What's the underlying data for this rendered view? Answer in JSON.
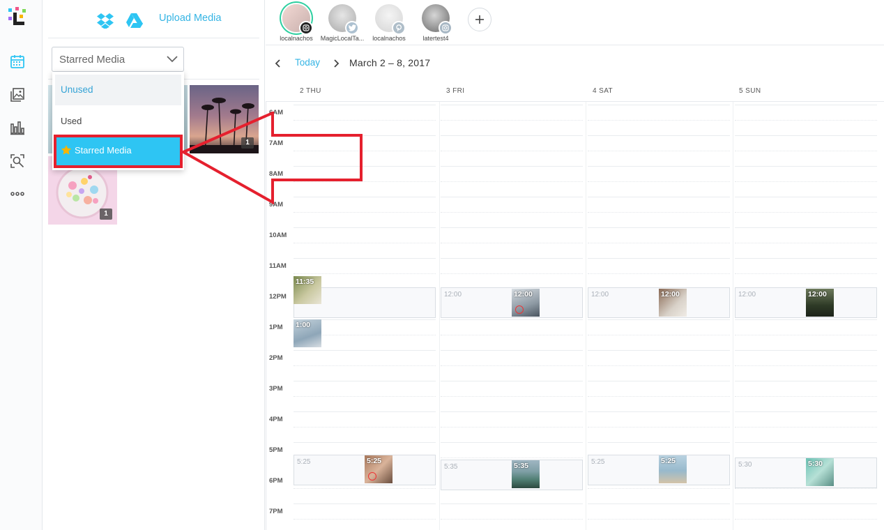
{
  "media_panel": {
    "upload_label": "Upload Media",
    "filter_value": "Starred Media",
    "dropdown": {
      "items": [
        {
          "label": "Unused",
          "state": "hover"
        },
        {
          "label": "Used",
          "state": "normal"
        },
        {
          "label": "Starred Media",
          "state": "selected"
        }
      ]
    },
    "thumbs": [
      {
        "badge": "1"
      },
      {
        "badge": "1"
      }
    ]
  },
  "accounts": [
    {
      "name": "localnachos",
      "network": "instagram",
      "active": true
    },
    {
      "name": "MagicLocalTa...",
      "network": "twitter",
      "active": false
    },
    {
      "name": "localnachos",
      "network": "pinterest",
      "active": false
    },
    {
      "name": "latertest4",
      "network": "instagram",
      "active": false
    }
  ],
  "datenav": {
    "today_label": "Today",
    "range": "March 2 – 8, 2017"
  },
  "days": [
    "2 THU",
    "3 FRI",
    "4 SAT",
    "5 SUN"
  ],
  "hours": [
    "6AM",
    "7AM",
    "8AM",
    "9AM",
    "10AM",
    "11AM",
    "12PM",
    "1PM",
    "2PM",
    "3PM",
    "4PM",
    "5PM",
    "6PM",
    "7PM"
  ],
  "slots": {
    "noon": [
      "12:00",
      "12:00",
      "12:00"
    ],
    "evening": [
      "5:25",
      "5:35",
      "5:25",
      "5:30"
    ]
  },
  "posts": {
    "thu_1135": "11:35",
    "thu_100": "1:00",
    "fri_1200": "12:00",
    "sat_1200": "12:00",
    "sun_1200": "12:00",
    "thu_525": "5:25",
    "fri_535": "5:35",
    "sat_525": "5:25",
    "sun_530": "5:30"
  },
  "colors": {
    "accent": "#34b4e4",
    "selected": "#2ec5f3",
    "highlight_red": "#e5202e"
  }
}
